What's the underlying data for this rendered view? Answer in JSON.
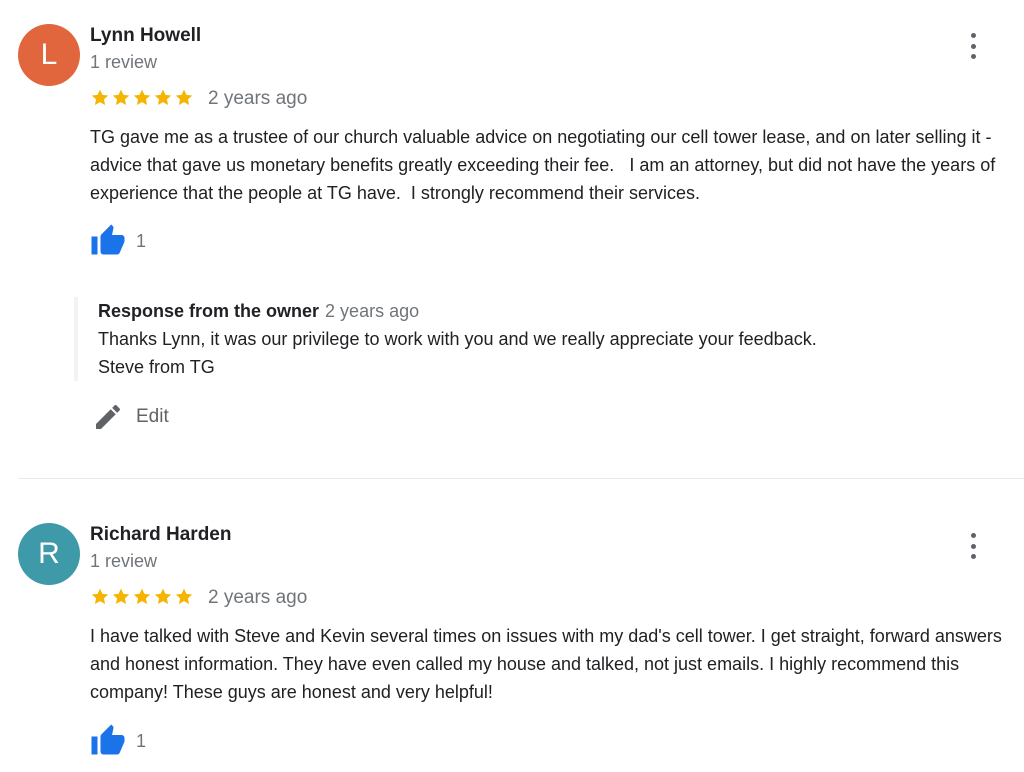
{
  "reviews": [
    {
      "avatar_initial": "L",
      "avatar_color": "#e2663d",
      "name": "Lynn Howell",
      "review_count": "1 review",
      "rating": 5,
      "date": "2 years ago",
      "text": "TG gave me as a trustee of our church valuable advice on negotiating our cell tower lease, and on later selling it - advice that gave us monetary benefits greatly exceeding their fee.   I am an attorney, but did not have the years of experience that the people at TG have.  I strongly recommend their services.",
      "likes": "1",
      "owner_response": {
        "title": "Response from the owner",
        "date": "2 years ago",
        "text": "Thanks Lynn, it was our privilege to work with you and we really appreciate your feedback.\nSteve from TG"
      },
      "edit_label": "Edit"
    },
    {
      "avatar_initial": "R",
      "avatar_color": "#3e9aa8",
      "name": "Richard Harden",
      "review_count": "1 review",
      "rating": 5,
      "date": "2 years ago",
      "text": "I have talked with Steve and Kevin several times on issues with my dad's cell tower. I get straight, forward answers and honest information. They have even called my house and talked, not just emails. I highly recommend this company! These guys are honest and very helpful!",
      "likes": "1"
    }
  ],
  "colors": {
    "star": "#f4b400",
    "like_blue": "#1a73e8",
    "secondary_text": "#70757a"
  },
  "icons": {
    "star": "star-icon",
    "like": "thumbs-up-icon",
    "more": "more-vert-icon",
    "edit": "pencil-icon"
  }
}
